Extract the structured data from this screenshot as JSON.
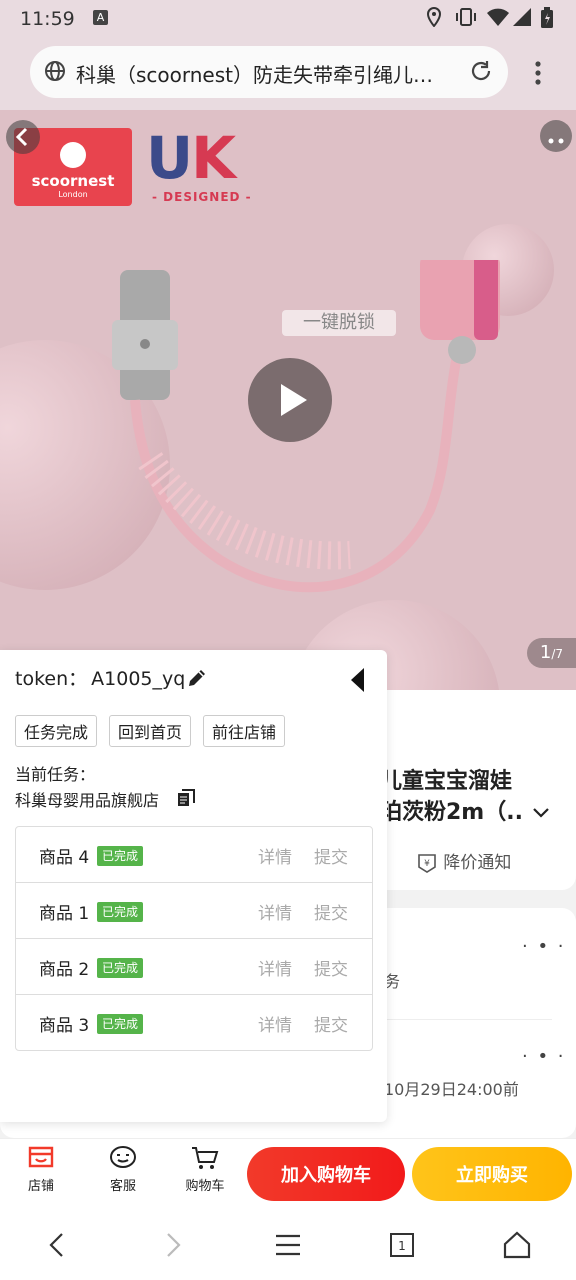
{
  "status_bar": {
    "time": "11:59",
    "app_letter": "A"
  },
  "browser": {
    "page_title": "科巢（scoornest）防走失带牵引绳儿…"
  },
  "hero": {
    "logo_brand": "scoornest",
    "logo_sub": "London",
    "uk_u": "U",
    "uk_k": "K",
    "designed": "- DESIGNED -",
    "unlock_tag": "一键脱锁",
    "counter_current": "1",
    "counter_total": "/7"
  },
  "product": {
    "title_line1": "儿童宝宝溜娃",
    "title_line2": "珀茨粉2m（..",
    "price_notify": "降价通知",
    "service_text": "务",
    "deadline_text": "10月29日24:00前"
  },
  "panel": {
    "token_label": "token：",
    "token_value": "A1005_yq",
    "buttons": [
      "任务完成",
      "回到首页",
      "前往店铺"
    ],
    "task_label": "当前任务：",
    "task_shop": "科巢母婴用品旗舰店",
    "goods": [
      {
        "name": "商品 4",
        "status": "已完成",
        "detail": "详情",
        "submit": "提交"
      },
      {
        "name": "商品 1",
        "status": "已完成",
        "detail": "详情",
        "submit": "提交"
      },
      {
        "name": "商品 2",
        "status": "已完成",
        "detail": "详情",
        "submit": "提交"
      },
      {
        "name": "商品 3",
        "status": "已完成",
        "detail": "详情",
        "submit": "提交"
      }
    ]
  },
  "actions": {
    "store": "店铺",
    "service": "客服",
    "cart": "购物车",
    "add_to_cart": "加入购物车",
    "buy_now": "立即购买"
  },
  "colors": {
    "accent_red": "#f21a1a",
    "accent_yellow": "#ffb400",
    "done_green": "#55b44a"
  }
}
